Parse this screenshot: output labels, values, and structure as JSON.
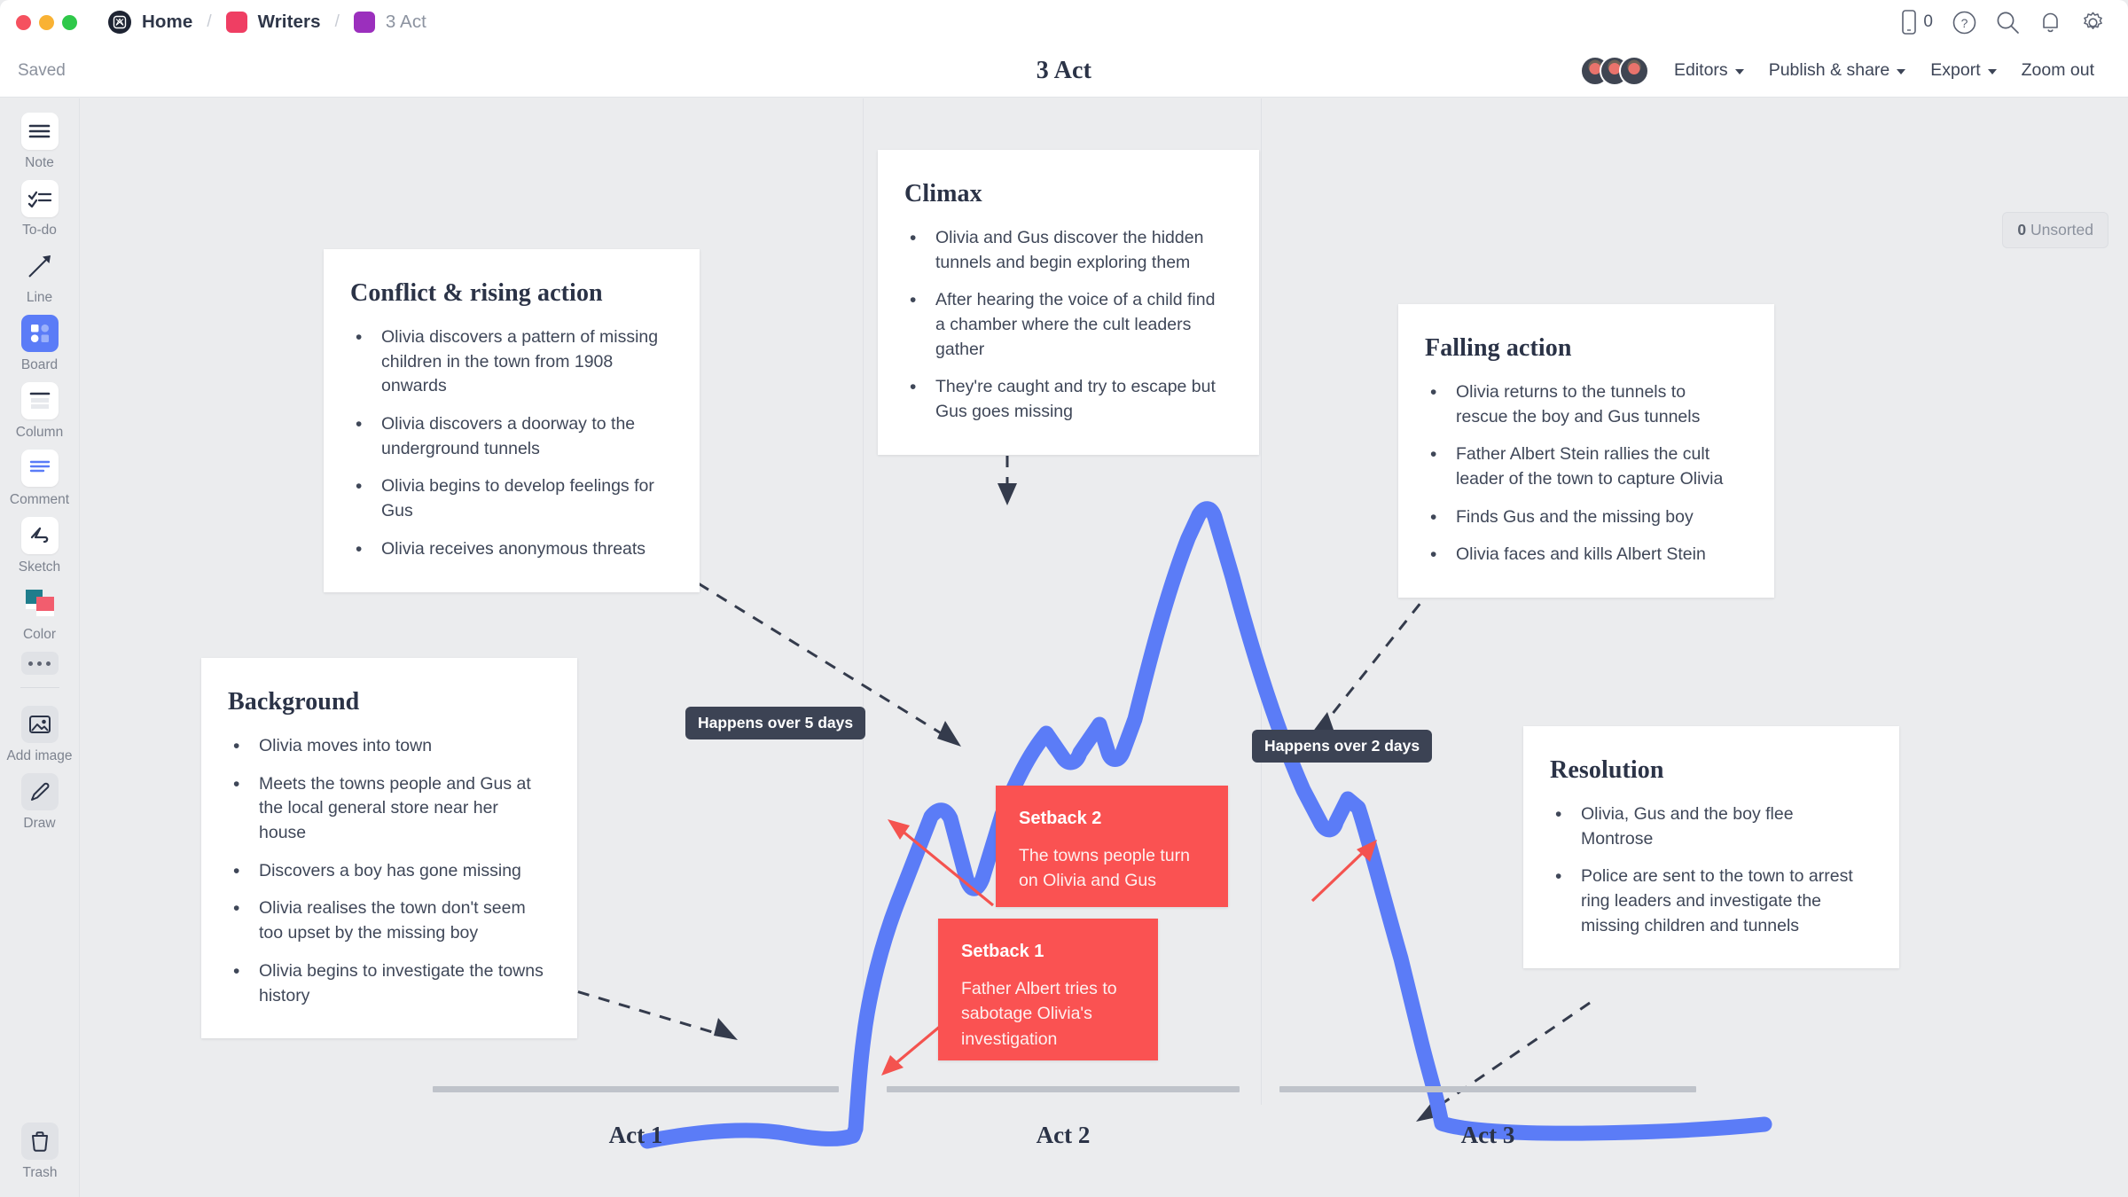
{
  "window": {
    "traffic_lights": [
      "close",
      "minimize",
      "zoom"
    ]
  },
  "breadcrumbs": [
    {
      "label": "Home",
      "icon": "milanote-logo-icon"
    },
    {
      "label": "Writers",
      "icon": "pink-square-icon"
    },
    {
      "label": "3 Act",
      "icon": "purple-square-icon"
    }
  ],
  "topbar": {
    "mobile_count": "0",
    "icons": [
      "mobile-icon",
      "help-icon",
      "search-icon",
      "bell-icon",
      "gear-icon"
    ]
  },
  "subbar": {
    "saved_label": "Saved",
    "doc_title": "3 Act",
    "editors_label": "Editors",
    "publish_label": "Publish & share",
    "export_label": "Export",
    "zoom_out_label": "Zoom out",
    "avatar_count": 3
  },
  "sidebar": {
    "tools": [
      {
        "label": "Note",
        "icon": "note-icon"
      },
      {
        "label": "To-do",
        "icon": "todo-icon"
      },
      {
        "label": "Line",
        "icon": "line-arrow-icon"
      },
      {
        "label": "Board",
        "icon": "board-icon"
      },
      {
        "label": "Column",
        "icon": "column-icon"
      },
      {
        "label": "Comment",
        "icon": "comment-icon"
      },
      {
        "label": "Sketch",
        "icon": "sketch-icon"
      },
      {
        "label": "Color",
        "icon": "color-swatch-icon"
      }
    ],
    "more_label": "more-options",
    "extras": [
      {
        "label": "Add image",
        "icon": "add-image-icon"
      },
      {
        "label": "Draw",
        "icon": "draw-pencil-icon"
      }
    ],
    "trash_label": "Trash"
  },
  "canvas": {
    "unsorted_count": "0",
    "unsorted_label": "Unsorted",
    "acts": [
      "Act 1",
      "Act 2",
      "Act 3"
    ],
    "chips": [
      {
        "text": "Happens over 5 days"
      },
      {
        "text": "Happens over 2 days"
      }
    ],
    "cards": [
      {
        "title": "Conflict & rising action",
        "items": [
          "Olivia discovers a pattern of missing children in the town from 1908 onwards",
          "Olivia discovers a doorway to the underground tunnels",
          "Olivia begins to develop feelings for Gus",
          "Olivia receives anonymous threats"
        ]
      },
      {
        "title": "Climax",
        "items": [
          "Olivia and Gus discover the hidden tunnels and begin exploring them",
          "After hearing the voice of a child find a chamber where the cult leaders gather",
          "They're caught and try to escape but Gus goes missing"
        ]
      },
      {
        "title": "Falling action",
        "items": [
          "Olivia returns to the tunnels to rescue the boy and Gus tunnels",
          "Father Albert Stein rallies the cult leader of the town to capture Olivia",
          "Finds Gus and the missing boy",
          "Olivia faces and kills Albert Stein"
        ]
      },
      {
        "title": "Background",
        "items": [
          "Olivia moves into town",
          "Meets the towns people and Gus at the local general store near her house",
          "Discovers a boy has gone missing",
          "Olivia realises the town don't seem too upset by the missing boy",
          "Olivia begins to investigate the towns history"
        ]
      },
      {
        "title": "Resolution",
        "items": [
          "Olivia, Gus and the boy flee Montrose",
          "Police are sent to the town to arrest ring leaders and investigate the missing children and tunnels"
        ]
      }
    ],
    "setbacks": [
      {
        "title": "Setback 2",
        "body": "The towns people turn on Olivia and Gus"
      },
      {
        "title": "Setback 1",
        "body": "Father Albert tries to sabotage Olivia's investigation"
      }
    ]
  },
  "colors": {
    "story_curve": "#5b7cf7",
    "setback": "#fa5252",
    "chip": "#3c4354",
    "canvas_bg": "#ebecee",
    "accent_blue": "#5b7cf7",
    "text": "#2b3347"
  }
}
